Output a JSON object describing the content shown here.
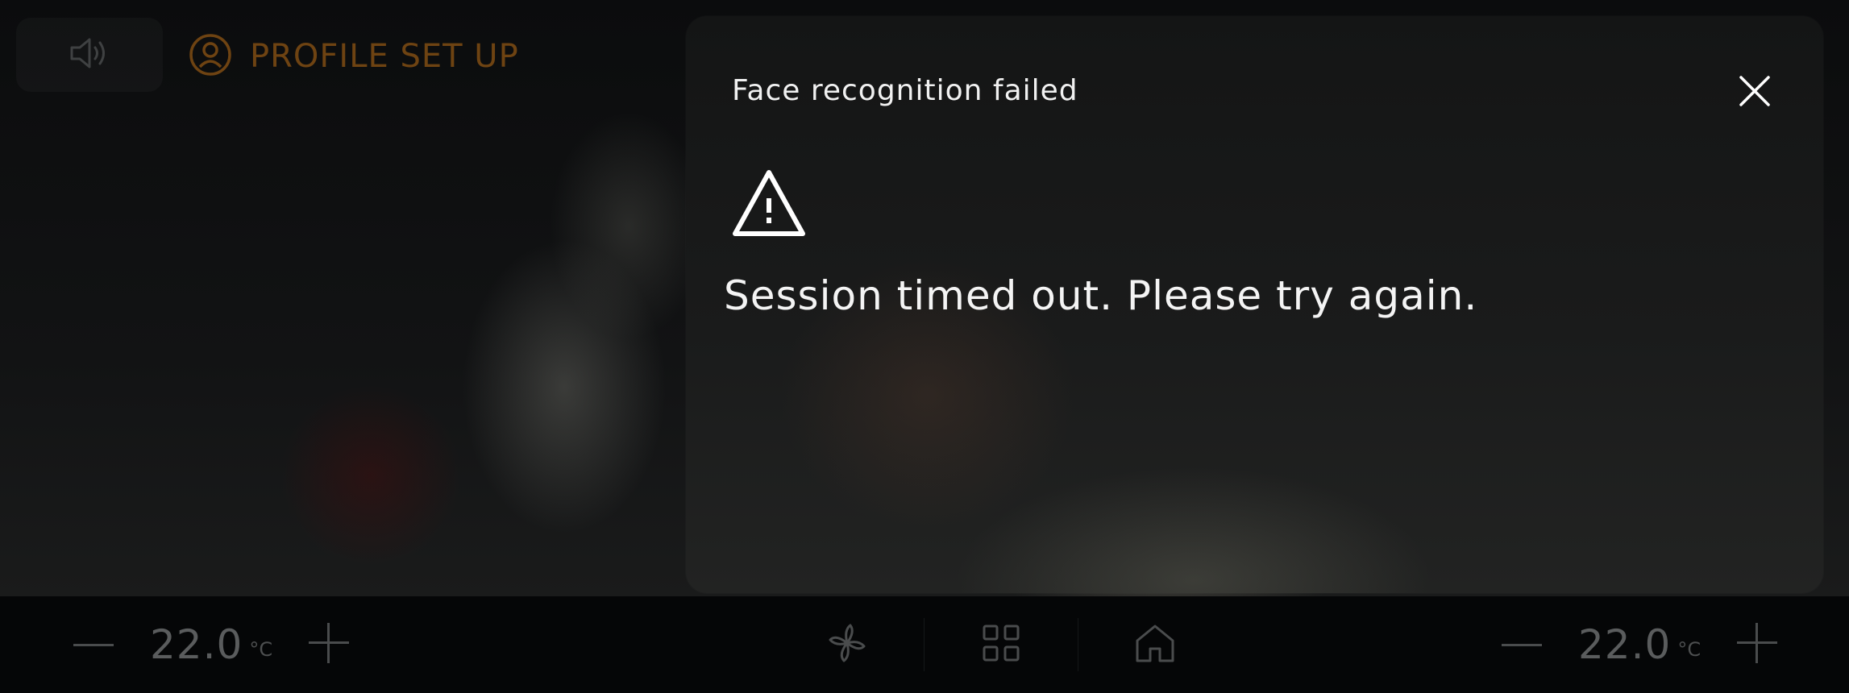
{
  "topbar": {
    "sound_icon": "speaker-icon",
    "profile_icon": "user-circle-icon",
    "profile_label": "PROFILE SET UP"
  },
  "dialog": {
    "title": "Face recognition failed",
    "close_icon": "close-icon",
    "warning_icon": "warning-triangle-icon",
    "message": "Session timed out. Please try again."
  },
  "climate": {
    "left": {
      "temperature": "22.0",
      "unit": "°C"
    },
    "right": {
      "temperature": "22.0",
      "unit": "°C"
    }
  },
  "nav": {
    "fan_icon": "fan-icon",
    "apps_icon": "grid-icon",
    "home_icon": "home-icon"
  },
  "colors": {
    "accent_profile": "#6e4312",
    "dialog_text": "#f1f1f1",
    "temp_text": "#5a5c5d"
  }
}
